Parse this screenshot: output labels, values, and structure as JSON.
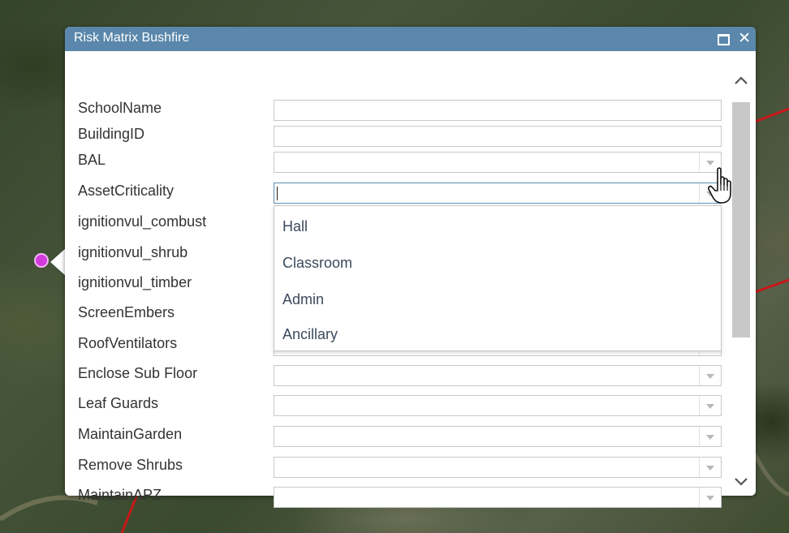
{
  "popup": {
    "title": "Risk Matrix Bushfire",
    "maximize_icon": "maximize-icon",
    "close_icon": "✕",
    "accent_color": "#5a87ab"
  },
  "fields": [
    {
      "label": "SchoolName",
      "type": "text",
      "value": ""
    },
    {
      "label": "BuildingID",
      "type": "text",
      "value": ""
    },
    {
      "label": "BAL",
      "type": "select",
      "value": ""
    },
    {
      "label": "AssetCriticality",
      "type": "select",
      "value": "",
      "active": true
    },
    {
      "label": "ignitionvul_combust",
      "type": "select",
      "value": ""
    },
    {
      "label": "ignitionvul_shrub",
      "type": "select",
      "value": ""
    },
    {
      "label": "ignitionvul_timber",
      "type": "select",
      "value": ""
    },
    {
      "label": "ScreenEmbers",
      "type": "select",
      "value": ""
    },
    {
      "label": "RoofVentilators",
      "type": "select",
      "value": ""
    },
    {
      "label": "Enclose Sub Floor",
      "type": "select",
      "value": ""
    },
    {
      "label": "Leaf Guards",
      "type": "select",
      "value": ""
    },
    {
      "label": "MaintainGarden",
      "type": "select",
      "value": ""
    },
    {
      "label": "Remove Shrubs",
      "type": "select",
      "value": ""
    },
    {
      "label": "MaintainAPZ",
      "type": "select",
      "value": ""
    }
  ],
  "dropdown": {
    "options": [
      "Hall",
      "Classroom",
      "Admin",
      "Ancillary"
    ]
  },
  "map": {
    "marker_color": "#d13bdc",
    "boundary_color": "#d11a1a"
  }
}
